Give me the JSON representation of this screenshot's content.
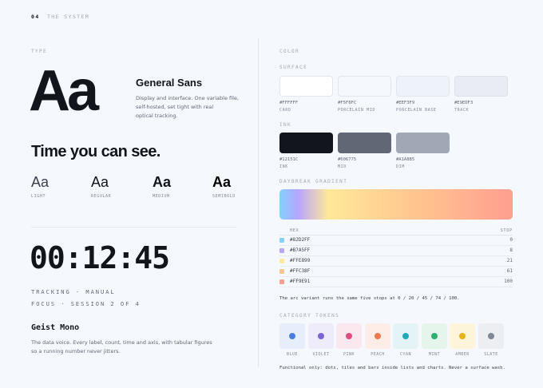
{
  "header": {
    "section_number": "04",
    "section_title": "THE SYSTEM"
  },
  "type_section": {
    "eyebrow": "TYPE",
    "specimen": "Aa",
    "font_name": "General Sans",
    "font_description": [
      "Display and interface. One variable file,",
      "self-hosted, set tight with real",
      "optical tracking."
    ],
    "headline": "Time you can see.",
    "weights": [
      {
        "sample": "Aa",
        "label": "LIGHT"
      },
      {
        "sample": "Aa",
        "label": "REGULAR"
      },
      {
        "sample": "Aa",
        "label": "MEDIUM"
      },
      {
        "sample": "Aa",
        "label": "SEMIBOLD"
      }
    ],
    "timer": "00:12:45",
    "meta_line_1": "TRACKING · MANUAL",
    "meta_line_2": "FOCUS · SESSION 2 OF 4",
    "mono_name": "Geist Mono",
    "mono_description": [
      "The data voice. Every label, count, time and axis, with tabular figures",
      "so a running number never jitters."
    ]
  },
  "color_section": {
    "eyebrow": "COLOR",
    "surface_label": "SURFACE",
    "surface": [
      {
        "hex": "#FFFFFF",
        "name": "CARD",
        "color": "#FFFFFF"
      },
      {
        "hex": "#F5F8FC",
        "name": "PORCELAIN MID",
        "color": "#F5F8FC"
      },
      {
        "hex": "#EEF3F9",
        "name": "PORCELAIN BASE",
        "color": "#EEF3F9"
      },
      {
        "hex": "#E9EDF3",
        "name": "TRACK",
        "color": "#E9EDF3"
      }
    ],
    "ink_label": "INK",
    "ink": [
      {
        "hex": "#12151C",
        "name": "INK",
        "color": "#12151C"
      },
      {
        "hex": "#606775",
        "name": "MID",
        "color": "#606775"
      },
      {
        "hex": "#A1A8B5",
        "name": "DIM",
        "color": "#A1A8B5"
      }
    ],
    "gradient_label": "DAYBREAK GRADIENT",
    "gradient_header": {
      "hex": "HEX",
      "stop": "STOP"
    },
    "gradient_stops": [
      {
        "hex": "#82D2FF",
        "stop": "0",
        "color": "#82D2FF"
      },
      {
        "hex": "#B7A5FF",
        "stop": "8",
        "color": "#B7A5FF"
      },
      {
        "hex": "#FFE899",
        "stop": "21",
        "color": "#FFE899"
      },
      {
        "hex": "#FFC38F",
        "stop": "61",
        "color": "#FFC38F"
      },
      {
        "hex": "#FF9E91",
        "stop": "100",
        "color": "#FF9E91"
      }
    ],
    "gradient_note": "The arc variant runs the same five stops at 0 / 20 / 45 / 74 / 100.",
    "category_label": "CATEGORY TOKENS",
    "categories": [
      {
        "name": "BLUE",
        "bg": "#e7eefb",
        "dot": "#4a7fe0"
      },
      {
        "name": "VIOLET",
        "bg": "#eeebfa",
        "dot": "#7c63d6"
      },
      {
        "name": "PINK",
        "bg": "#fbe8ef",
        "dot": "#e0507f"
      },
      {
        "name": "PEACH",
        "bg": "#fdede6",
        "dot": "#f0784c"
      },
      {
        "name": "CYAN",
        "bg": "#e4f4f6",
        "dot": "#1fa9b8"
      },
      {
        "name": "MINT",
        "bg": "#e5f5ec",
        "dot": "#30b070"
      },
      {
        "name": "AMBER",
        "bg": "#fdf5d9",
        "dot": "#e6b21e"
      },
      {
        "name": "SLATE",
        "bg": "#eceef2",
        "dot": "#808795"
      }
    ],
    "category_note": "Functional only: dots, tiles and bars inside lists and charts. Never a surface wash."
  }
}
